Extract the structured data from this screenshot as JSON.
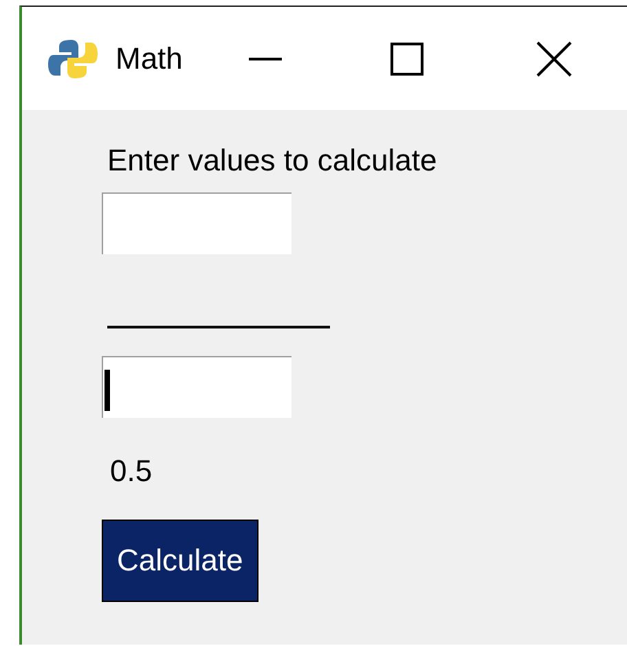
{
  "window": {
    "title": "Math"
  },
  "prompt": "Enter values to calculate",
  "fields": [
    {
      "focused": false
    },
    {
      "focused": true
    }
  ],
  "result": "0.5",
  "button": "Calculate"
}
